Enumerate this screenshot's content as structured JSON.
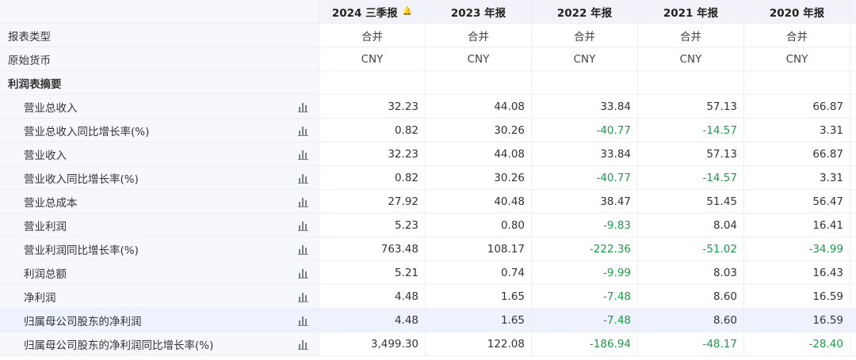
{
  "columns": [
    {
      "label": "2024 三季报",
      "has_bell": true
    },
    {
      "label": "2023 年报"
    },
    {
      "label": "2022 年报"
    },
    {
      "label": "2021 年报"
    },
    {
      "label": "2020 年报"
    }
  ],
  "meta_rows": [
    {
      "label": "报表类型",
      "values": [
        "合并",
        "合并",
        "合并",
        "合并",
        "合并"
      ]
    },
    {
      "label": "原始货币",
      "values": [
        "CNY",
        "CNY",
        "CNY",
        "CNY",
        "CNY"
      ]
    }
  ],
  "section_title": "利润表摘要",
  "rows": [
    {
      "label": "营业总收入",
      "values": [
        "32.23",
        "44.08",
        "33.84",
        "57.13",
        "66.87"
      ]
    },
    {
      "label": "营业总收入同比增长率(%)",
      "values": [
        "0.82",
        "30.26",
        "-40.77",
        "-14.57",
        "3.31"
      ]
    },
    {
      "label": "营业收入",
      "values": [
        "32.23",
        "44.08",
        "33.84",
        "57.13",
        "66.87"
      ]
    },
    {
      "label": "营业收入同比增长率(%)",
      "values": [
        "0.82",
        "30.26",
        "-40.77",
        "-14.57",
        "3.31"
      ]
    },
    {
      "label": "营业总成本",
      "values": [
        "27.92",
        "40.48",
        "38.47",
        "51.45",
        "56.47"
      ]
    },
    {
      "label": "营业利润",
      "values": [
        "5.23",
        "0.80",
        "-9.83",
        "8.04",
        "16.41"
      ]
    },
    {
      "label": "营业利润同比增长率(%)",
      "values": [
        "763.48",
        "108.17",
        "-222.36",
        "-51.02",
        "-34.99"
      ]
    },
    {
      "label": "利润总额",
      "values": [
        "5.21",
        "0.74",
        "-9.99",
        "8.03",
        "16.43"
      ]
    },
    {
      "label": "净利润",
      "values": [
        "4.48",
        "1.65",
        "-7.48",
        "8.60",
        "16.59"
      ]
    },
    {
      "label": "归属母公司股东的净利润",
      "values": [
        "4.48",
        "1.65",
        "-7.48",
        "8.60",
        "16.59"
      ],
      "highlight": true
    },
    {
      "label": "归属母公司股东的净利润同比增长率(%)",
      "values": [
        "3,499.30",
        "122.08",
        "-186.94",
        "-48.17",
        "-28.40"
      ]
    }
  ],
  "colors": {
    "negative": "#1a9b4b",
    "bell": "#ef4a4a",
    "header_bg": "#f2f3f8",
    "highlight_bg": "#eef2fc"
  },
  "icons": {
    "row_chart": "bar-chart-icon",
    "column_alert": "bell-icon"
  }
}
